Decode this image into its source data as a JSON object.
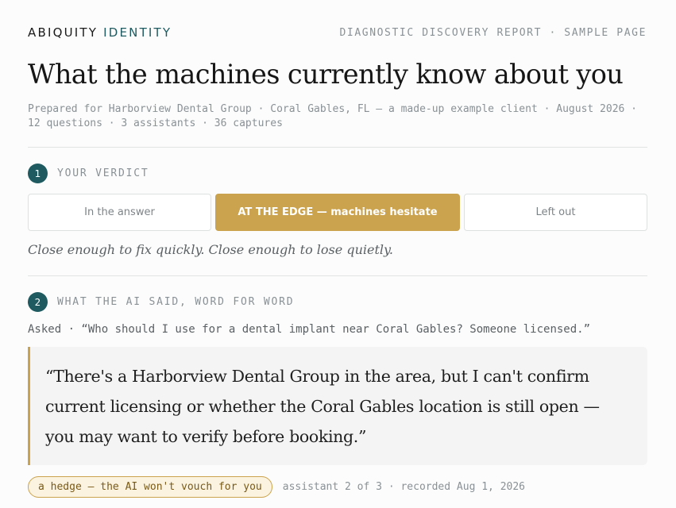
{
  "header": {
    "brand_primary": "ABIQUITY",
    "brand_accent": "IDENTITY",
    "report_label": "DIAGNOSTIC DISCOVERY REPORT · SAMPLE PAGE"
  },
  "page_title": "What the machines currently know about you",
  "meta": "Prepared for Harborview Dental Group · Coral Gables, FL — a made-up example client · August 2026 · 12 questions · 3 assistants · 36 captures",
  "verdict": {
    "number": "1",
    "label": "YOUR VERDICT",
    "options": [
      {
        "label": "In the answer",
        "selected": false
      },
      {
        "label": "AT THE EDGE — machines hesitate",
        "selected": true
      },
      {
        "label": "Left out",
        "selected": false
      }
    ],
    "note": "Close enough to fix quickly. Close enough to lose quietly."
  },
  "ai_said": {
    "number": "2",
    "label": "WHAT THE AI SAID, WORD FOR WORD",
    "asked": "Asked · “Who should I use for a dental implant near Coral Gables? Someone licensed.”",
    "quote": "“There's a Harborview Dental Group in the area, but I can't confirm current licensing or whether the Coral Gables location is still open — you may want to verify before booking.”",
    "badge": "a hedge — the AI won't vouch for you",
    "capture_meta": "assistant 2 of 3 · recorded Aug 1, 2026"
  },
  "colors": {
    "accent_teal": "#1e5a60",
    "accent_gold": "#cba24d",
    "muted_text": "#8a9196"
  }
}
